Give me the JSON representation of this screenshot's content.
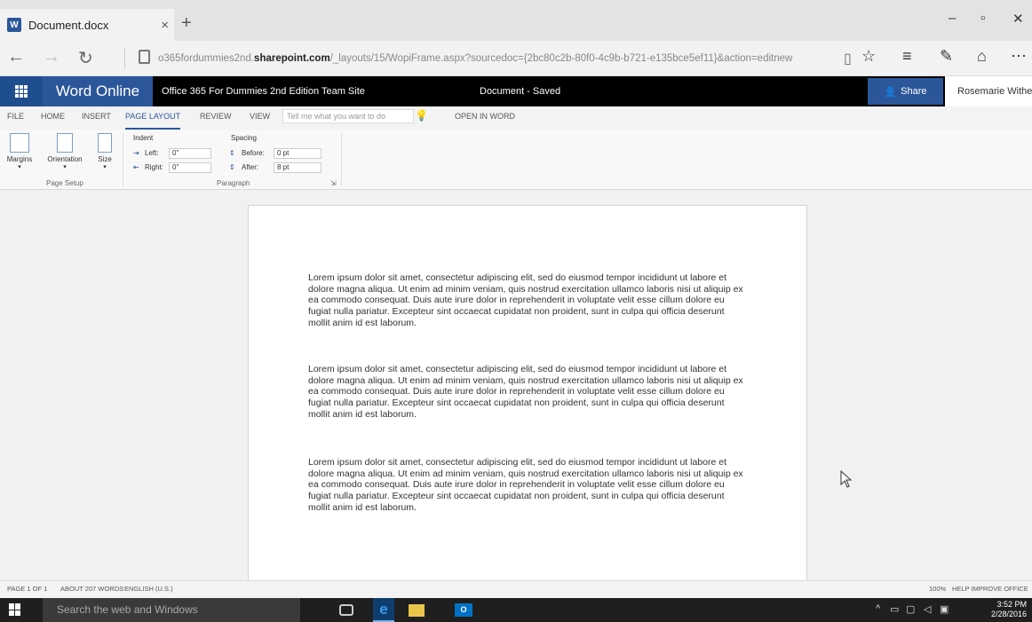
{
  "browser": {
    "tab_title": "Document.docx",
    "tab_close": "×",
    "new_tab": "+",
    "url_prefix": "o365fordummies2nd.",
    "url_domain": "sharepoint.com",
    "url_path": "/_layouts/15/WopiFrame.aspx?sourcedoc={2bc80c2b-80f0-4c9b-b721-e135bce5ef11}&action=editnew",
    "win_minimize": "–",
    "win_maximize": "▫",
    "win_close": "✕"
  },
  "word": {
    "app_name": "Word Online",
    "site_name": "Office 365 For Dummies 2nd Edition Team Site",
    "doc_status": "Document   -   Saved",
    "share_label": "Share",
    "user_name": "Rosemarie Withee"
  },
  "ribbon": {
    "tabs": [
      "FILE",
      "HOME",
      "INSERT",
      "PAGE LAYOUT",
      "REVIEW",
      "VIEW"
    ],
    "active_tab": "PAGE LAYOUT",
    "tell_me_placeholder": "Tell me what you want to do",
    "open_in_word": "OPEN IN WORD",
    "page_setup": {
      "margins": "Margins",
      "orientation": "Orientation",
      "size": "Size",
      "group_label": "Page Setup"
    },
    "paragraph": {
      "indent_label": "Indent",
      "left_label": "Left:",
      "left_value": "0\"",
      "right_label": "Right:",
      "right_value": "0\"",
      "spacing_label": "Spacing",
      "before_label": "Before:",
      "before_value": "0 pt",
      "after_label": "After:",
      "after_value": "8 pt",
      "group_label": "Paragraph"
    }
  },
  "document": {
    "paragraphs": [
      "Lorem ipsum dolor sit amet, consectetur adipiscing elit, sed do eiusmod tempor incididunt ut labore et dolore magna aliqua. Ut enim ad minim veniam, quis nostrud exercitation ullamco laboris nisi ut aliquip ex ea commodo consequat. Duis aute irure dolor in reprehenderit in voluptate velit esse cillum dolore eu fugiat nulla pariatur. Excepteur sint occaecat cupidatat non proident, sunt in culpa qui officia deserunt mollit anim id est laborum.",
      "Lorem ipsum dolor sit amet, consectetur adipiscing elit, sed do eiusmod tempor incididunt ut labore et dolore magna aliqua. Ut enim ad minim veniam, quis nostrud exercitation ullamco laboris nisi ut aliquip ex ea commodo consequat. Duis aute irure dolor in reprehenderit in voluptate velit esse cillum dolore eu fugiat nulla pariatur. Excepteur sint occaecat cupidatat non proident, sunt in culpa qui officia deserunt mollit anim id est laborum.",
      "Lorem ipsum dolor sit amet, consectetur adipiscing elit, sed do eiusmod tempor incididunt ut labore et dolore magna aliqua. Ut enim ad minim veniam, quis nostrud exercitation ullamco laboris nisi ut aliquip ex ea commodo consequat. Duis aute irure dolor in reprehenderit in voluptate velit esse cillum dolore eu fugiat nulla pariatur. Excepteur sint occaecat cupidatat non proident, sunt in culpa qui officia deserunt mollit anim id est laborum."
    ]
  },
  "status": {
    "page": "PAGE 1 OF 1",
    "words": "ABOUT 207 WORDS",
    "language": "ENGLISH (U.S.)",
    "zoom": "100%",
    "help": "HELP IMPROVE OFFICE"
  },
  "taskbar": {
    "search_placeholder": "Search the web and Windows",
    "time": "3:52 PM",
    "date": "2/28/2016"
  },
  "colors": {
    "word_blue": "#2b579a",
    "header_black": "#000000"
  }
}
